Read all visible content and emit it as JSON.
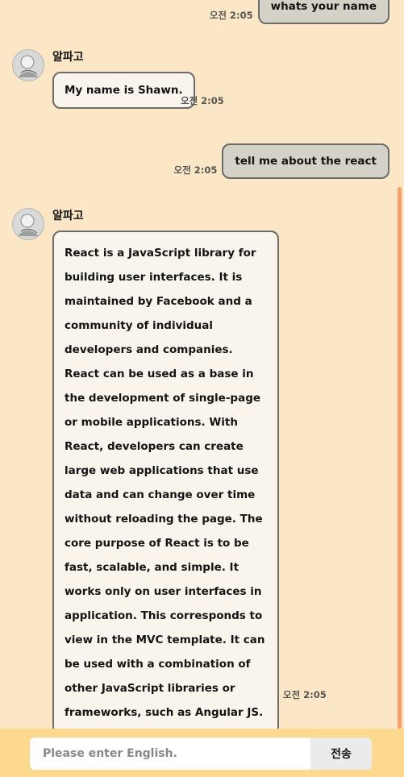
{
  "messages": [
    {
      "sender": "user",
      "text": "whats your name",
      "time": "오전 2:05"
    },
    {
      "sender": "bot",
      "name": "알파고",
      "text": "My name is Shawn.",
      "time": "오전 2:05"
    },
    {
      "sender": "user",
      "text": "tell me about the react",
      "time": "오전 2:05"
    },
    {
      "sender": "bot",
      "name": "알파고",
      "text": "React is a JavaScript library for building user interfaces. It is maintained by Facebook and a community of individual developers and companies. React can be used as a base in the development of single-page or mobile applications. With React, developers can create large web applications that use data and can change over time without reloading the page. The core purpose of React is to be fast, scalable, and simple. It works only on user interfaces in application. This corresponds to view in the MVC template. It can be used with a combination of other JavaScript libraries or frameworks, such as Angular JS.",
      "time": "오전 2:05"
    }
  ],
  "input": {
    "placeholder": "Please enter English.",
    "value": ""
  },
  "send_button": {
    "label": "전송"
  },
  "icons": {
    "avatar": "alphago-avatar"
  },
  "colors": {
    "background": "#fbe7c6",
    "user_bubble": "#d4d1c6",
    "bot_bubble": "#faf5ec",
    "footer": "#fdd98f",
    "scrollbar": "#f3a06a"
  }
}
